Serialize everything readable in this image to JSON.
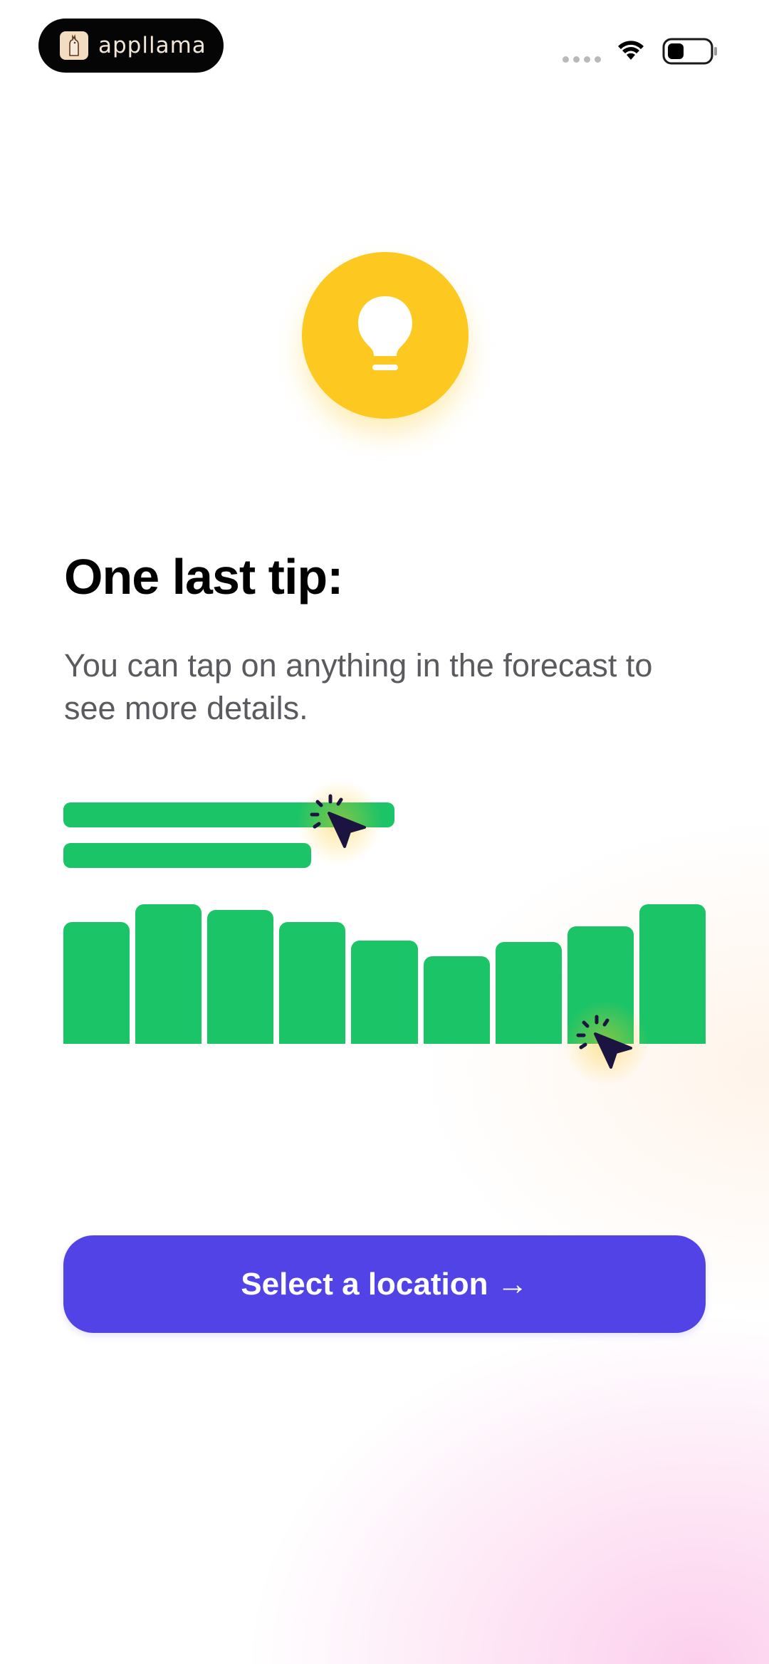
{
  "status_bar": {
    "brand": "appllama",
    "icons": [
      "signal-dots-icon",
      "wifi-icon",
      "battery-icon"
    ]
  },
  "tip": {
    "icon": "lightbulb-icon",
    "title": "One last tip:",
    "description": "You can tap on anything in the forecast to see more details."
  },
  "illustration": {
    "bar_color": "#1cc468",
    "horizontal_bars": [
      1.0,
      0.75
    ],
    "columns": [
      0.87,
      1.0,
      0.96,
      0.87,
      0.74,
      0.63,
      0.73,
      0.84,
      1.0
    ],
    "cursor_icon": "tap-cursor-icon"
  },
  "cta": {
    "label": "Select a location →",
    "color": "#5143e6"
  },
  "colors": {
    "accent_yellow": "#fdc81f",
    "title": "#000000",
    "body_text": "#5a5a5f"
  }
}
